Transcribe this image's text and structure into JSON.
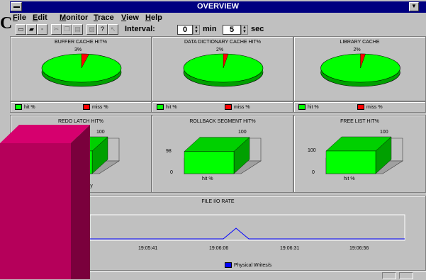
{
  "window": {
    "title": "OVERVIEW",
    "min_glyph": "▼"
  },
  "logo": "C",
  "menu": [
    {
      "id": "file",
      "label": "File"
    },
    {
      "id": "edit",
      "label": "Edit"
    },
    {
      "id": "monitor",
      "label": "Monitor"
    },
    {
      "id": "trace",
      "label": "Trace"
    },
    {
      "id": "view",
      "label": "View"
    },
    {
      "id": "help",
      "label": "Help"
    }
  ],
  "toolbar": {
    "interval_label": "Interval:",
    "min_value": "0",
    "min_unit": "min",
    "sec_value": "5",
    "sec_unit": "sec"
  },
  "pies": [
    {
      "title": "BUFFER CACHE HIT%",
      "miss_label": "3%",
      "hit_label": "97%",
      "hit": 97,
      "miss": 3
    },
    {
      "title": "DATA DICTIONARY CACHE HIT%",
      "miss_label": "2%",
      "hit_label": "98%",
      "hit": 98,
      "miss": 2
    },
    {
      "title": "LIBRARY CACHE",
      "miss_label": "2%",
      "hit_label": "98%",
      "hit": 98,
      "miss": 2
    }
  ],
  "legend": {
    "hit": "hit %",
    "miss": "miss %"
  },
  "bars": [
    {
      "title": "REDO LATCH HIT%",
      "value": 100,
      "top_label": "100",
      "left_label": "",
      "zero_label": "",
      "x_label": "copy",
      "legend": "redo copy"
    },
    {
      "title": "ROLLBACK SEGMENT HIT%",
      "value": 98,
      "top_label": "100",
      "left_label": "98",
      "zero_label": "0",
      "x_label": "hit %",
      "legend": ""
    },
    {
      "title": "FREE LIST HIT%",
      "value": 100,
      "top_label": "100",
      "left_label": "100",
      "zero_label": "0",
      "x_label": "hit %",
      "legend": ""
    }
  ],
  "file_io": {
    "title": "FILE I/O RATE",
    "ticks": [
      "19:05:41",
      "19:06:06",
      "19:06:31",
      "19:06:56"
    ],
    "legend": "Physical Writes/s",
    "color": "#0000ff"
  },
  "colors": {
    "hit": "#00ff00",
    "miss": "#ff0000",
    "overlay": "#b5005a",
    "titlebar": "#000080"
  }
}
